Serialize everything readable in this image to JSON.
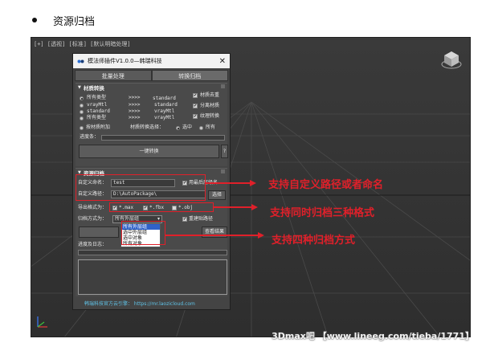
{
  "heading": {
    "text": "资源归档"
  },
  "viewport": {
    "label": "[+] [透视] [标准] [默认明暗处理]"
  },
  "dialog": {
    "title": "模法师插件V1.0.0—韩瑞科技",
    "tabs": [
      "批量处理",
      "转换归档"
    ],
    "material": {
      "section_title": "材质转换",
      "rows": [
        {
          "from": "所有类型",
          "arrow": ">>>>",
          "to": "standard"
        },
        {
          "from": "vrayMtl",
          "arrow": ">>>>",
          "to": "standard"
        },
        {
          "from": "standard",
          "arrow": ">>>>",
          "to": "vrayMtl"
        },
        {
          "from": "所有类型",
          "arrow": ">>>>",
          "to": "vrayMtl"
        }
      ],
      "checks": [
        "材质去重",
        "分离材质",
        "纹理转换"
      ],
      "mat_attach": "按材质附加",
      "conv_select_label": "材质转换选择：",
      "opt_selected": "选中",
      "opt_all": "所有",
      "progress_label": "进度条：",
      "convert_button": "一键转换",
      "help_button": "?"
    },
    "archive": {
      "section_title": "资源归档",
      "name_label": "自定义命名：",
      "name_value": "test",
      "use_last_name": "用最后层级名",
      "path_label": "自定义路径：",
      "path_value": "D:\\AutoPackage\\",
      "select_button": "选择",
      "format_label": "导出格式为：",
      "formats": [
        "*.max",
        "*.fbx",
        "*.obj"
      ],
      "method_label": "归档方式为：",
      "method_value": "所有外层组",
      "method_options": [
        "所有外层组",
        "选中外层组",
        "选中对象",
        "所有对象"
      ],
      "relink_path": "重建贴路径",
      "view_result": "查看结果",
      "log_label": "进度及日志："
    },
    "footer_link": "韩瑞科技官方云引擎： https://mr.laozicloud.com"
  },
  "callouts": [
    "支持自定义路径或者命名",
    "支持同时归档三种格式",
    "支持四种归档方式"
  ],
  "watermark": "3Dmax吧 【www.lineeg.com/tieba/1771】",
  "colors": {
    "annotation_red": "#e0202a",
    "viewport_bg": "#333333",
    "selection_blue": "#2f62c9"
  }
}
